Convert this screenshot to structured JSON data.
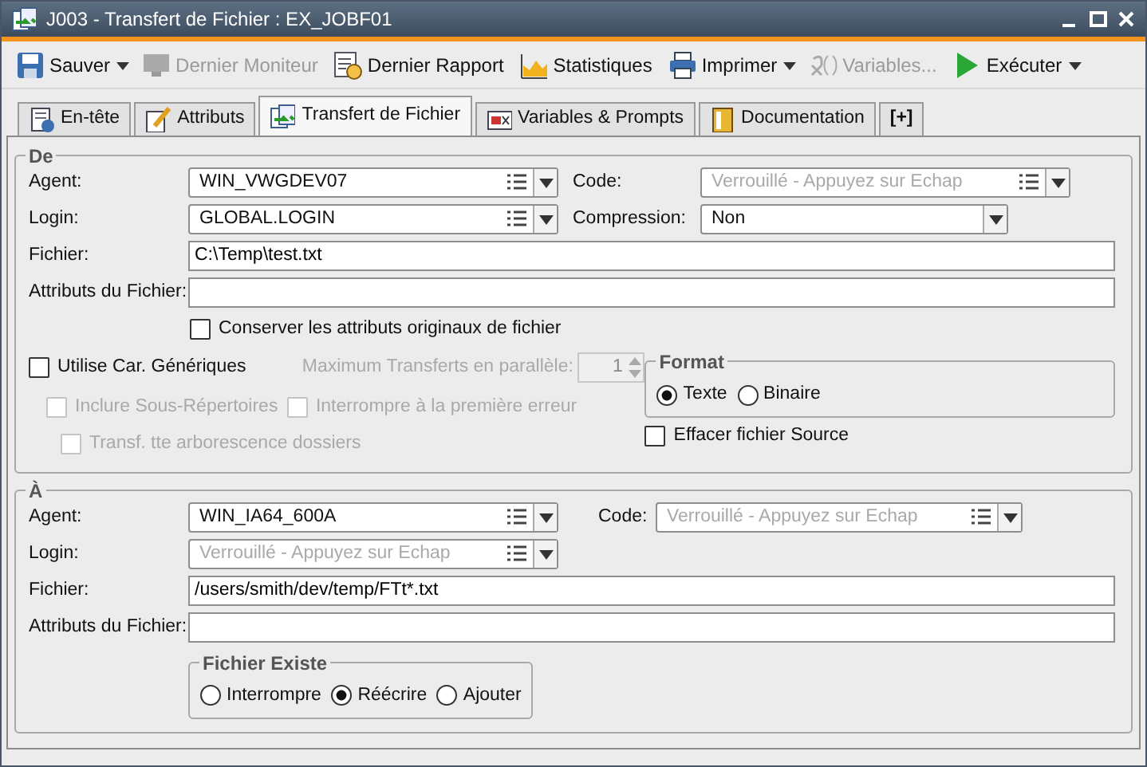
{
  "window": {
    "title": "J003 - Transfert de Fichier : EX_JOBF01"
  },
  "toolbar": [
    {
      "label": "Sauver",
      "disabled": false,
      "dropdown": true
    },
    {
      "label": "Dernier Moniteur",
      "disabled": true,
      "dropdown": false
    },
    {
      "label": "Dernier Rapport",
      "disabled": false,
      "dropdown": false
    },
    {
      "label": "Statistiques",
      "disabled": false,
      "dropdown": false
    },
    {
      "label": "Imprimer",
      "disabled": false,
      "dropdown": true
    },
    {
      "label": "Variables...",
      "disabled": true,
      "dropdown": false
    },
    {
      "label": "Exécuter",
      "disabled": false,
      "dropdown": true
    }
  ],
  "tabs": [
    {
      "label": "En-tête",
      "selected": false
    },
    {
      "label": "Attributs",
      "selected": false
    },
    {
      "label": "Transfert de Fichier",
      "selected": true
    },
    {
      "label": "Variables & Prompts",
      "selected": false
    },
    {
      "label": "Documentation",
      "selected": false
    },
    {
      "label": "[+]",
      "selected": false
    }
  ],
  "source": {
    "legend": "De",
    "agent": {
      "label": "Agent:",
      "value": "WIN_VWGDEV07"
    },
    "code": {
      "label": "Code:",
      "placeholder": "Verrouillé - Appuyez sur Echap"
    },
    "login": {
      "label": "Login:",
      "value": "GLOBAL.LOGIN"
    },
    "compression": {
      "label": "Compression:",
      "value": "Non"
    },
    "file": {
      "label": "Fichier:",
      "value": "C:\\Temp\\test.txt"
    },
    "file_attributes": {
      "label": "Attributs du Fichier:"
    },
    "keep_attributes": {
      "label": "Conserver les attributs originaux de fichier",
      "checked": false,
      "disabled": false
    },
    "wildcards": {
      "label": "Utilise Car. Génériques",
      "checked": false,
      "disabled": false
    },
    "max_transfers": {
      "label": "Maximum Transferts en parallèle:",
      "value": "1",
      "disabled": true
    },
    "include_subdirs": {
      "label": "Inclure Sous-Répertoires",
      "checked": false,
      "disabled": true
    },
    "stop_on_error": {
      "label": "Interrompre à la première erreur",
      "checked": false,
      "disabled": true
    },
    "transfer_tree": {
      "label": "Transf. tte arborescence dossiers",
      "checked": false,
      "disabled": true
    },
    "format": {
      "legend": "Format",
      "options": [
        {
          "label": "Texte",
          "selected": true
        },
        {
          "label": "Binaire",
          "selected": false
        }
      ]
    },
    "delete_source": {
      "label": "Effacer fichier Source",
      "checked": false,
      "disabled": false
    }
  },
  "destination": {
    "legend": "À",
    "agent": {
      "label": "Agent:",
      "value": "WIN_IA64_600A"
    },
    "code": {
      "label": "Code:",
      "placeholder": "Verrouillé - Appuyez sur Echap"
    },
    "login": {
      "label": "Login:",
      "placeholder": "Verrouillé - Appuyez sur Echap"
    },
    "file": {
      "label": "Fichier:",
      "value": "/users/smith/dev/temp/FTt*.txt"
    },
    "file_attributes": {
      "label": "Attributs du Fichier:"
    },
    "file_exists": {
      "legend": "Fichier Existe",
      "options": [
        {
          "label": "Interrompre",
          "selected": false
        },
        {
          "label": "Réécrire",
          "selected": true
        },
        {
          "label": "Ajouter",
          "selected": false
        }
      ]
    }
  }
}
